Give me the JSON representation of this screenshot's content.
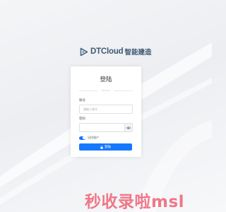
{
  "brand": {
    "name": "DTCloud",
    "tagline": "智能建造"
  },
  "login_form": {
    "title": "登陆",
    "divider_text": "DTCloud",
    "account_label": "账号",
    "account_placeholder": "请输入账号",
    "password_label": "密码",
    "password_placeholder": "",
    "remember_label": "记住账户",
    "remember_checked": true,
    "submit_label": "登陆"
  },
  "watermark": "秒收录啦msl",
  "colors": {
    "primary": "#1677ff",
    "brand": "#3f5a74",
    "watermark": "#ec566c"
  },
  "icons": {
    "brand": "dtcloud-logo-icon",
    "password_toggle": "eye-icon",
    "submit": "lock-icon"
  }
}
